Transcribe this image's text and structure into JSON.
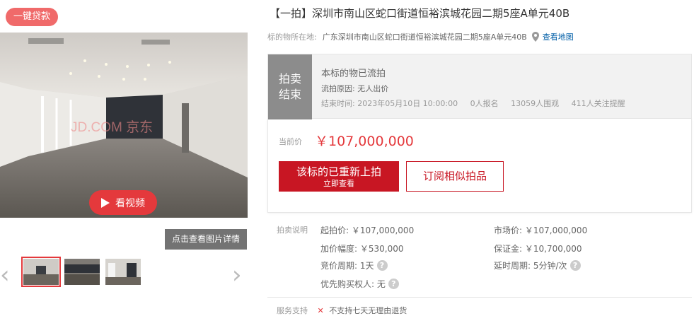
{
  "gallery": {
    "loan_badge": "一键贷款",
    "watermark": "JD.COM 京东",
    "video_label": "看视频",
    "detail_label": "点击查看图片详情",
    "prev_arrow": "‹",
    "next_arrow": "›",
    "thumb_count": 3,
    "active_thumb": 0
  },
  "listing": {
    "title": "【一拍】深圳市南山区蛇口街道恒裕滨城花园二期5座A单元40B",
    "location_label": "标的物所在地:",
    "location_value": "广东深圳市南山区蛇口街道恒裕滨城花园二期5座A单元40B",
    "map_link": "查看地图"
  },
  "status": {
    "tag_line1": "拍卖",
    "tag_line2": "结束",
    "main": "本标的物已流拍",
    "reason": "流拍原因:  无人出价",
    "end_time": "结束时间:   2023年05月10日 10:00:00",
    "signups": "0人报名",
    "views": "13059人围观",
    "followers": "411人关注提醒"
  },
  "price": {
    "label": "当前价",
    "value": "￥107,000,000",
    "primary_btn_l1": "该标的已重新上拍",
    "primary_btn_l2": "立即查看",
    "secondary_btn": "订阅相似拍品"
  },
  "info": {
    "section_label": "拍卖说明",
    "start_price": "起拍价:  ￥107,000,000",
    "market_price": "市场价:  ￥107,000,000",
    "increment": "加价幅度:  ￥530,000",
    "deposit": "保证金:  ￥10,700,000",
    "cycle": "竞价周期:  1天",
    "delay": "延时周期:  5分钟/次",
    "priority": "优先购买权人:  无",
    "help_icon": "?"
  },
  "service": {
    "label": "服务支持",
    "mark": "✕",
    "text": "不支持七天无理由退货"
  },
  "colors": {
    "accent_red": "#e4393c",
    "button_red": "#c81623",
    "status_gray": "#8c8c8c",
    "link_blue": "#005ea7"
  }
}
